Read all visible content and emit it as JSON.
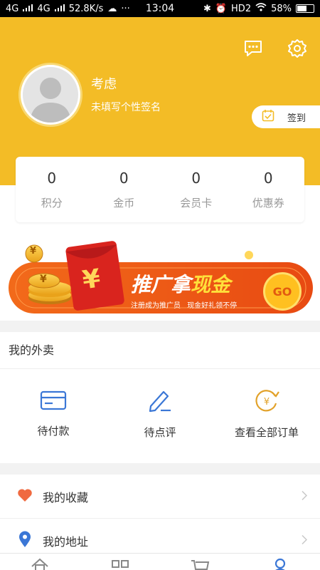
{
  "status_bar": {
    "network_1": "4G",
    "network_2": "4G",
    "speed": "52.8K/s",
    "time": "13:04",
    "hd": "HD2",
    "battery": "58%"
  },
  "profile": {
    "name": "考虑",
    "signature": "未填写个性签名",
    "checkin_label": "签到"
  },
  "stats": [
    {
      "value": "0",
      "label": "积分"
    },
    {
      "value": "0",
      "label": "金币"
    },
    {
      "value": "0",
      "label": "会员卡"
    },
    {
      "value": "0",
      "label": "优惠券"
    }
  ],
  "banner": {
    "title_main": "推广拿",
    "title_highlight": "现金",
    "subtitle_1": "注册成为推广员",
    "subtitle_2": "现金好礼领不停",
    "go_label": "GO",
    "yen_symbol": "¥"
  },
  "orders": {
    "title": "我的外卖",
    "items": [
      {
        "label": "待付款",
        "icon": "card-icon"
      },
      {
        "label": "待点评",
        "icon": "pen-icon"
      },
      {
        "label": "查看全部订单",
        "icon": "yen-refresh-icon"
      }
    ]
  },
  "menu": [
    {
      "label": "我的收藏",
      "icon": "heart-icon"
    },
    {
      "label": "我的地址",
      "icon": "location-icon"
    }
  ],
  "tabbar": [
    "home-icon",
    "grid-icon",
    "cart-icon",
    "user-icon"
  ],
  "colors": {
    "brand": "#f3bc26",
    "accent_blue": "#3b77d6",
    "heart": "#f06a40",
    "banner_orange": "#f26a1a",
    "banner_red": "#d9241e"
  }
}
